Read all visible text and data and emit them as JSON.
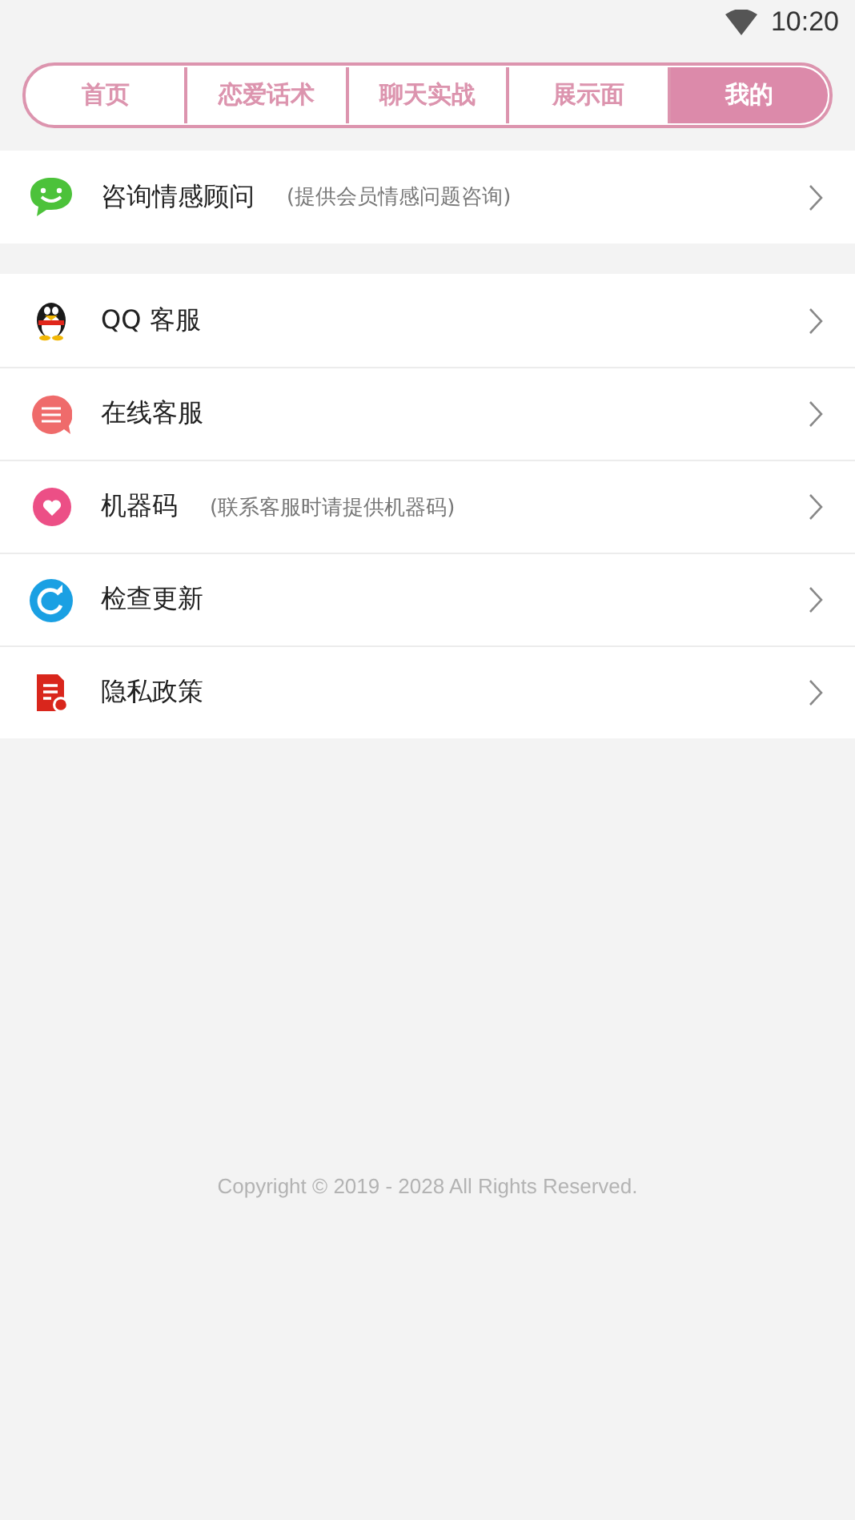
{
  "status_bar": {
    "time": "10:20"
  },
  "tabs": [
    {
      "label": "首页",
      "selected": false
    },
    {
      "label": "恋爱话术",
      "selected": false
    },
    {
      "label": "聊天实战",
      "selected": false
    },
    {
      "label": "展示面",
      "selected": false
    },
    {
      "label": "我的",
      "selected": true
    }
  ],
  "groups": [
    {
      "items": [
        {
          "kind": "chat",
          "label": "咨询情感顾问",
          "note": "(提供会员情感问题咨询)"
        }
      ]
    },
    {
      "items": [
        {
          "kind": "penguin",
          "label": "QQ 客服"
        },
        {
          "kind": "service",
          "label": "在线客服"
        },
        {
          "kind": "heart",
          "label": "机器码",
          "note": "(联系客服时请提供机器码)"
        },
        {
          "kind": "update",
          "label": "检查更新"
        },
        {
          "kind": "policy",
          "label": "隐私政策"
        }
      ]
    }
  ],
  "footer": {
    "copyright": "Copyright © 2019 - 2028 All Rights Reserved."
  }
}
